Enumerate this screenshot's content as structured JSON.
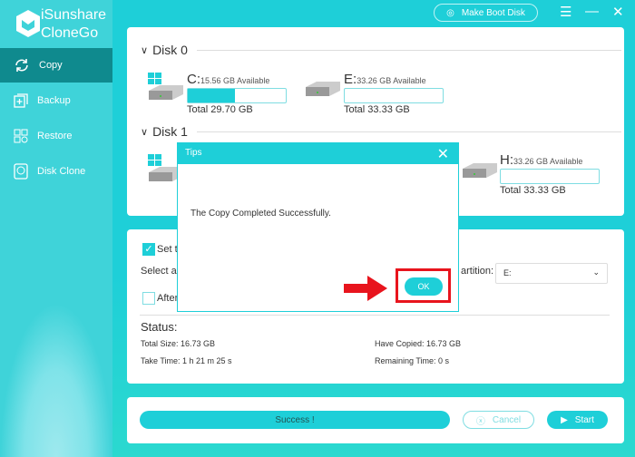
{
  "app": {
    "name_line1": "iSunshare",
    "name_line2": "CloneGo"
  },
  "sidebar": {
    "items": [
      {
        "label": "Copy",
        "icon": "sync-icon",
        "active": true
      },
      {
        "label": "Backup",
        "icon": "backup-icon"
      },
      {
        "label": "Restore",
        "icon": "restore-icon"
      },
      {
        "label": "Disk Clone",
        "icon": "disk-clone-icon"
      }
    ]
  },
  "header": {
    "boot_label": "Make Boot Disk"
  },
  "disks": [
    {
      "name": "Disk 0",
      "partitions": [
        {
          "letter": "C:",
          "available": "15.56 GB Available",
          "total": "Total 29.70 GB",
          "used_percent": 48,
          "windows": true
        },
        {
          "letter": "E:",
          "available": "33.26 GB Available",
          "total": "Total 33.33 GB",
          "used_percent": 0
        }
      ]
    },
    {
      "name": "Disk 1",
      "partitions": [
        {
          "letter": "H:",
          "available": "33.26 GB Available",
          "total": "Total 33.33 GB",
          "used_percent": 0
        }
      ]
    }
  ],
  "options": {
    "set_label": "Set t",
    "set_checked": true,
    "select_label": "Select a",
    "partition_label": "artition:",
    "partition_value": "E:",
    "after_label": "After",
    "after_checked": false
  },
  "status": {
    "title": "Status:",
    "total_size": "Total Size: 16.73 GB",
    "have_copied": "Have Copied: 16.73 GB",
    "take_time": "Take Time: 1 h 21 m 25 s",
    "remaining": "Remaining Time: 0 s"
  },
  "actions": {
    "progress_label": "Success !",
    "progress_percent": 100,
    "cancel": "Cancel",
    "start": "Start"
  },
  "dialog": {
    "title": "Tips",
    "message": "The Copy Completed Successfully.",
    "ok": "OK"
  },
  "colors": {
    "accent": "#1ecfd8",
    "active_nav": "#0f8a8e",
    "highlight": "#e8141d"
  }
}
